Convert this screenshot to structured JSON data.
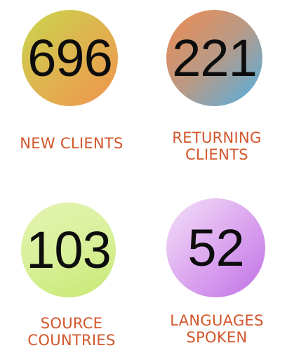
{
  "stats": [
    {
      "value": "696",
      "label": "NEW CLIENTS"
    },
    {
      "value": "221",
      "label": "RETURNING\nCLIENTS"
    },
    {
      "value": "103",
      "label": "SOURCE\nCOUNTRIES"
    },
    {
      "value": "52",
      "label": "LANGUAGES\nSPOKEN"
    }
  ],
  "colors": {
    "label": "#d2562b",
    "number": "#0d0d0d",
    "circle_1": [
      "#c9d64c",
      "#f0944d"
    ],
    "circle_2": [
      "#f08a4f",
      "#4fb0e6"
    ],
    "circle_3": [
      "#e4f3b2",
      "#c7e873"
    ],
    "circle_4": [
      "#f4e0f7",
      "#c070e6"
    ]
  }
}
